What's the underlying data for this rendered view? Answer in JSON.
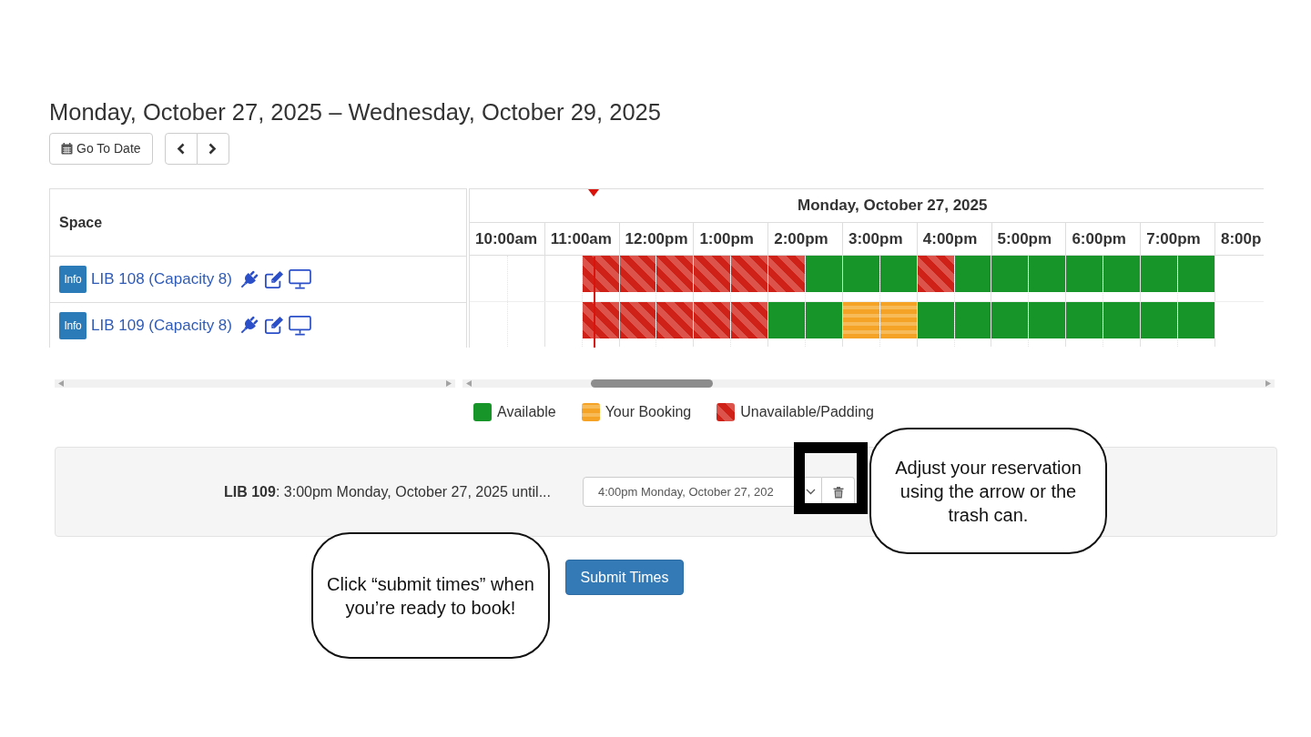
{
  "title": "Monday, October 27, 2025 – Wednesday, October 29, 2025",
  "toolbar": {
    "go_to_date": "Go To Date"
  },
  "grid": {
    "space_header": "Space",
    "day_header": "Monday, October 27, 2025",
    "current_time_marker": true,
    "hours": [
      "10:00am",
      "11:00am",
      "12:00pm",
      "1:00pm",
      "2:00pm",
      "3:00pm",
      "4:00pm",
      "5:00pm",
      "6:00pm",
      "7:00pm",
      "8:00p"
    ],
    "spaces": [
      {
        "info": "Info",
        "name": "LIB 108 (Capacity 8)",
        "slots": [
          {
            "kind": "empty"
          },
          {
            "kind": "empty"
          },
          {
            "kind": "empty"
          },
          {
            "kind": "unavailable"
          },
          {
            "kind": "unavailable"
          },
          {
            "kind": "unavailable"
          },
          {
            "kind": "unavailable"
          },
          {
            "kind": "unavailable"
          },
          {
            "kind": "unavailable"
          },
          {
            "kind": "available"
          },
          {
            "kind": "available"
          },
          {
            "kind": "available"
          },
          {
            "kind": "unavailable"
          },
          {
            "kind": "available"
          },
          {
            "kind": "available"
          },
          {
            "kind": "available"
          },
          {
            "kind": "available"
          },
          {
            "kind": "available"
          },
          {
            "kind": "available"
          },
          {
            "kind": "available"
          }
        ]
      },
      {
        "info": "Info",
        "name": "LIB 109 (Capacity 8)",
        "slots": [
          {
            "kind": "empty"
          },
          {
            "kind": "empty"
          },
          {
            "kind": "empty"
          },
          {
            "kind": "unavailable"
          },
          {
            "kind": "unavailable"
          },
          {
            "kind": "unavailable"
          },
          {
            "kind": "unavailable"
          },
          {
            "kind": "unavailable"
          },
          {
            "kind": "available"
          },
          {
            "kind": "available"
          },
          {
            "kind": "booking"
          },
          {
            "kind": "booking"
          },
          {
            "kind": "available"
          },
          {
            "kind": "available"
          },
          {
            "kind": "available"
          },
          {
            "kind": "available"
          },
          {
            "kind": "available"
          },
          {
            "kind": "available"
          },
          {
            "kind": "available"
          },
          {
            "kind": "available"
          }
        ]
      }
    ]
  },
  "legend": [
    {
      "kind": "available",
      "label": "Available"
    },
    {
      "kind": "booking",
      "label": "Your Booking"
    },
    {
      "kind": "unavailable",
      "label": "Unavailable/Padding"
    }
  ],
  "reservation": {
    "summary": "**LIB 109**: 3:00pm Monday, October 27, 2025 until...",
    "end_time": "4:00pm Monday, October 27, 202"
  },
  "submit": {
    "label": "Submit Times"
  },
  "annotations": {
    "highlight_frame": true,
    "callouts": [
      {
        "text": "Adjust your reservation using the arrow or the trash can."
      },
      {
        "text": "Click “submit times” when you’re ready to book!"
      }
    ]
  }
}
